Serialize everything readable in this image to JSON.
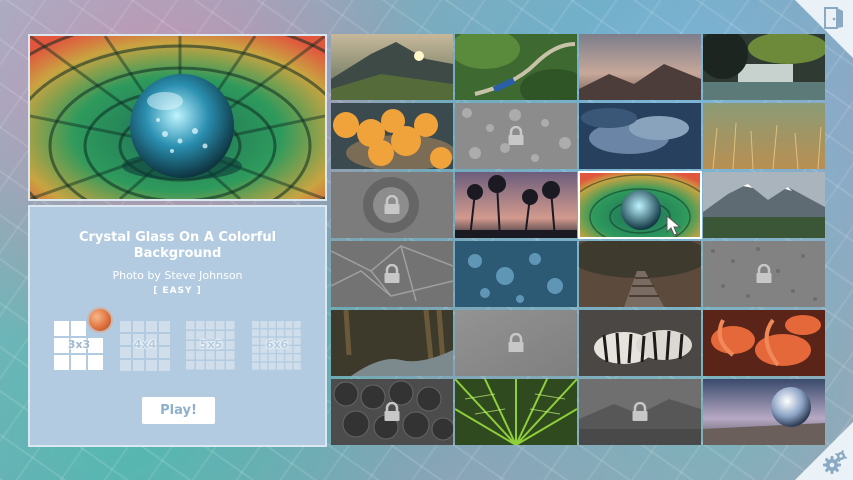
{
  "puzzle": {
    "title": "Crystal Glass On A Colorful Background",
    "credit": "Photo by Steve Johnson",
    "difficulty": "[ EASY ]",
    "sizes": [
      "3x3",
      "4x4",
      "5x5",
      "6x6"
    ],
    "selected_size": "3x3",
    "play_label": "Play!"
  },
  "icons": {
    "exit": "exit-door-icon",
    "settings": "gear-icon",
    "lock": "lock-icon"
  },
  "gallery": [
    {
      "name": "mountain-sunset",
      "locked": false,
      "current": false
    },
    {
      "name": "train-forest",
      "locked": false,
      "current": false
    },
    {
      "name": "misty-peaks",
      "locked": false,
      "current": false
    },
    {
      "name": "waterfall-cave",
      "locked": false,
      "current": false
    },
    {
      "name": "tangerines",
      "locked": false,
      "current": false
    },
    {
      "name": "water-drops",
      "locked": true,
      "current": false
    },
    {
      "name": "storm-clouds",
      "locked": false,
      "current": false
    },
    {
      "name": "wheat-field",
      "locked": false,
      "current": false
    },
    {
      "name": "bokeh-circle",
      "locked": true,
      "current": false
    },
    {
      "name": "palm-sunset",
      "locked": false,
      "current": false
    },
    {
      "name": "crystal-glass",
      "locked": false,
      "current": true
    },
    {
      "name": "alpine-lake",
      "locked": false,
      "current": false
    },
    {
      "name": "leaf-veins",
      "locked": true,
      "current": false
    },
    {
      "name": "blue-drops",
      "locked": false,
      "current": false
    },
    {
      "name": "railway-track",
      "locked": false,
      "current": false
    },
    {
      "name": "gravel-texture",
      "locked": true,
      "current": false
    },
    {
      "name": "forest-stream",
      "locked": false,
      "current": false
    },
    {
      "name": "foggy-gray",
      "locked": true,
      "current": false
    },
    {
      "name": "zebras",
      "locked": false,
      "current": false
    },
    {
      "name": "flamingos",
      "locked": false,
      "current": false
    },
    {
      "name": "berries",
      "locked": true,
      "current": false
    },
    {
      "name": "fern-leaf",
      "locked": false,
      "current": false
    },
    {
      "name": "gray-landscape",
      "locked": true,
      "current": false
    },
    {
      "name": "glass-ball-pier",
      "locked": false,
      "current": false
    }
  ]
}
